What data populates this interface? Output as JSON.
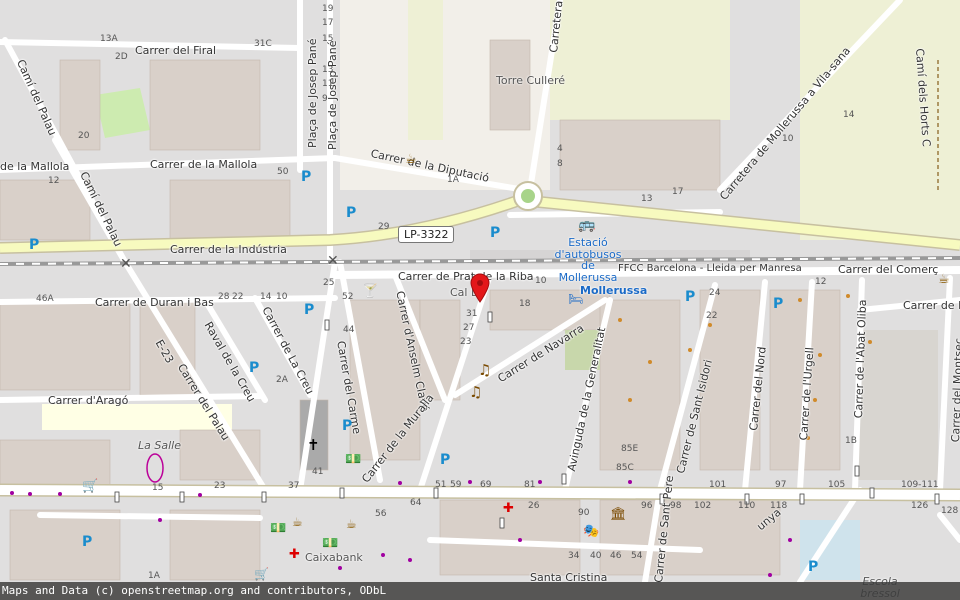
{
  "map": {
    "streets": {
      "firal": "Carrer del Firal",
      "mallola": "Carrer de la Mallola",
      "mallola_left": "de la Mallola",
      "diputacio": "Carrer de la Diputació",
      "industria": "Carrer de la Indústria",
      "prat_riba": "Carrer de Prat de la Riba",
      "comerc": "Carrer del Comerç",
      "duran_bas": "Carrer de Duran i Bas",
      "arago": "Carrer d'Aragó",
      "cami_palau_1": "Camí del Palau",
      "cami_palau_2": "Camí del Palau",
      "raval_creu": "Raval de la Creu",
      "carrer_creu": "Carrer de La Creu",
      "carrer_palau": "Carrer del Palau",
      "e23": "E-23",
      "placa_josep_1": "Plaça de Josep Pané",
      "placa_josep_2": "Plaça de Josep Pané",
      "carme": "Carrer del Carme",
      "anselm": "Carrer d'Anselm Clavé",
      "muralla": "Carrer de la Muralla",
      "navarra": "Carrer de Navarra",
      "generalitat": "Avinguda de la Generalitat",
      "sant_isidori": "Carrer de Sant Isidori",
      "nord": "Carrer del Nord",
      "urgell": "Carrer de l'Urgell",
      "abat_oliba": "Carrer de l'Abat Oliba",
      "montsec": "Carrer del Montsec",
      "carrer_e": "Carrer de E",
      "sant_pere": "Carrer de Sant Pere",
      "santa_cristina": "Santa Cristina",
      "carretera_c": "Carretera C",
      "vila_sana": "Carretera de Mollerussa a Vila-sana",
      "horts": "Camí dels Horts C",
      "ffcc": "FFCC Barcelona - Lleida per Manresa",
      "unya": "unya"
    },
    "road_ref": "LP-3322",
    "places": {
      "torre": "Torre Culleré",
      "estacio": "Estació d'autobusos de Mollerussa",
      "mollerussa": "Mollerussa",
      "cal_d": "Cal D",
      "la_salle": "La Salle",
      "caixabank": "Caixabank",
      "escola": "Escola bressol"
    },
    "house_numbers": {
      "n1": "19",
      "n2": "17",
      "n3": "15",
      "n4": "13",
      "n5": "11",
      "n6": "9",
      "n7": "13A",
      "n8": "31C",
      "n9": "2D",
      "n10": "20",
      "n11": "50",
      "n12": "1A",
      "n13": "29",
      "n14": "25",
      "n15": "52",
      "n16": "44",
      "n17": "46A",
      "n18": "28",
      "n19": "22",
      "n20": "14",
      "n21": "10",
      "n22": "31",
      "n23": "27",
      "n24": "23",
      "n25": "51",
      "n26": "59",
      "n27": "69",
      "n28": "81",
      "n29": "96",
      "n30": "98",
      "n31": "102",
      "n32": "110",
      "n33": "118",
      "n34": "126",
      "n35": "109-111",
      "n36": "105",
      "n37": "97",
      "n38": "101",
      "n39": "90",
      "n40": "34",
      "n41": "40",
      "n42": "46",
      "n43": "54",
      "n44": "85E",
      "n45": "85C",
      "n46": "12",
      "n47": "24",
      "n48": "22",
      "n49": "10",
      "n50": "18",
      "n51": "13",
      "n52": "17",
      "n53": "10",
      "n54": "14",
      "n55": "8",
      "n56": "4",
      "n57": "37",
      "n58": "41",
      "n59": "15",
      "n60": "23",
      "n61": "1A",
      "n62": "64",
      "n63": "56",
      "n64": "26",
      "n65": "1B",
      "n66": "12",
      "n67": "2A",
      "n68": "128"
    },
    "road_colors": {
      "secondary": "#f7fabf",
      "rail": "#999999"
    }
  },
  "attribution": "Maps and Data (c) openstreetmap.org and contributors, ODbL"
}
